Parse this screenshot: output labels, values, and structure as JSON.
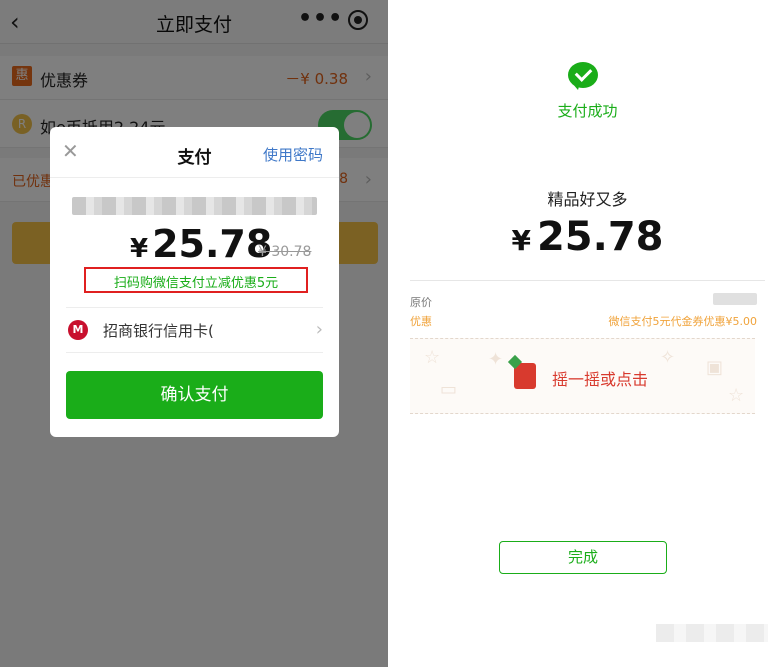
{
  "left": {
    "header": {
      "back_icon": "‹",
      "title": "立即支付",
      "more_icon": "•••",
      "target_icon": "target"
    },
    "coupon": {
      "icon": "惠",
      "label": "优惠券",
      "value": "－¥ 0.38",
      "chevron": "›"
    },
    "ecoin": {
      "icon": "R",
      "label": "如e币抵用2.24元"
    },
    "discount_row": {
      "label": "已优惠",
      "value": "78",
      "chevron": "›"
    },
    "modal": {
      "close_icon": "✕",
      "title": "支付",
      "password_link": "使用密码",
      "currency": "¥",
      "amount": "25.78",
      "original_amount": "¥ 30.78",
      "promo_text": "扫码购微信支付立减优惠5元",
      "bank_icon": "M",
      "bank_name": "招商银行信用卡(",
      "bank_chevron": "›",
      "confirm_label": "确认支付"
    }
  },
  "right": {
    "success_label": "支付成功",
    "merchant": "精品好又多",
    "currency": "¥",
    "amount": "25.78",
    "original_label": "原价",
    "discount_label": "优惠",
    "discount_value": "微信支付5元代金券优惠¥5.00",
    "shake_text": "摇一摇或点击",
    "done_label": "完成"
  },
  "colors": {
    "wechat_green": "#1aad19",
    "promo_red": "#e02020",
    "discount_orange": "#f0a33b"
  }
}
